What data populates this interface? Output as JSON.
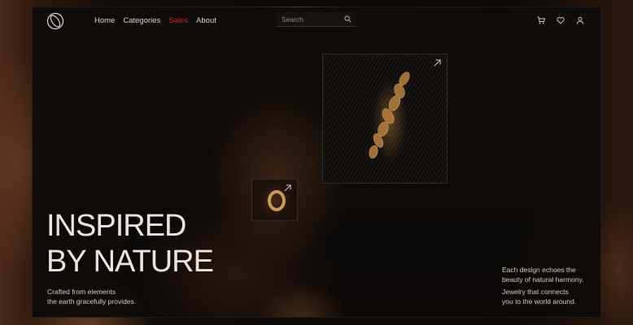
{
  "nav": {
    "items": [
      {
        "label": "Home"
      },
      {
        "label": "Categories"
      },
      {
        "label": "Sales"
      },
      {
        "label": "About"
      }
    ],
    "active_color": "#c8261f"
  },
  "search": {
    "placeholder": "Search"
  },
  "icons": [
    "logo-icon",
    "search-icon",
    "cart-icon",
    "heart-icon",
    "user-icon",
    "arrow-up-right-icon"
  ],
  "hero": {
    "title_line1": "INSPIRED",
    "title_line2": "BY NATURE",
    "subtitle": "Crafted from elements\nthe earth gracefully provides."
  },
  "side_text": {
    "paragraph1": "Each design echoes the\nbeauty of natural harmony.",
    "paragraph2": "Jewelry that connects\nyou to the world around."
  }
}
